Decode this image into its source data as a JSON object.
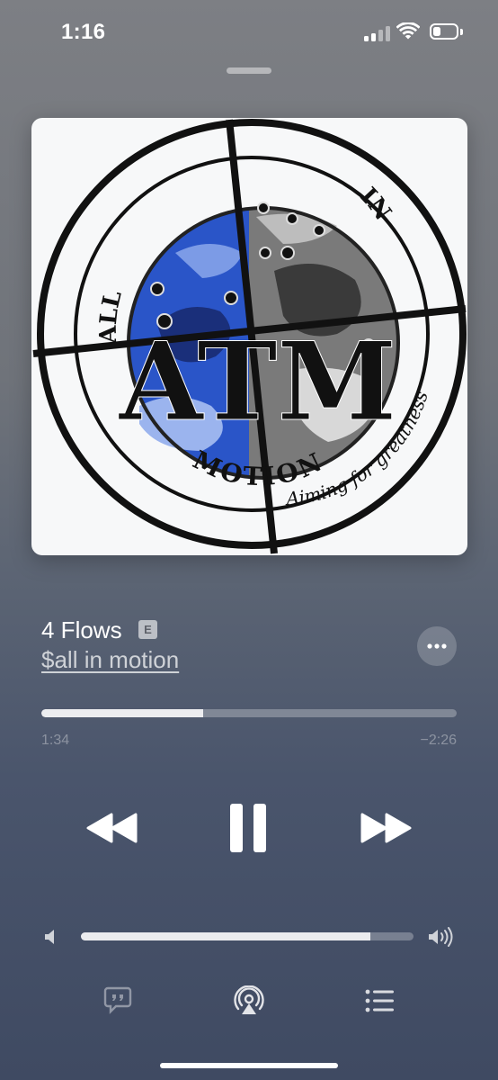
{
  "status_bar": {
    "time": "1:16",
    "signal_bars": 2,
    "battery_level": 0.35
  },
  "artwork": {
    "top_text": "IN",
    "left_text": "ALL",
    "center_monogram": "ATM",
    "bottom_text": "MOTION",
    "tagline": "Aiming for greatness"
  },
  "track": {
    "title": "4 Flows",
    "explicit_badge": "E",
    "artist": "$all in motion"
  },
  "playback": {
    "elapsed": "1:34",
    "remaining": "−2:26",
    "progress": 0.39,
    "state": "playing"
  },
  "volume": {
    "level": 0.87
  },
  "icons": {
    "more": "ellipsis-icon",
    "rewind": "rewind-icon",
    "pause": "pause-icon",
    "forward": "fast-forward-icon",
    "volume_low": "speaker-low-icon",
    "volume_high": "speaker-high-icon",
    "lyrics": "lyrics-icon",
    "airplay": "airplay-icon",
    "queue": "queue-list-icon"
  }
}
